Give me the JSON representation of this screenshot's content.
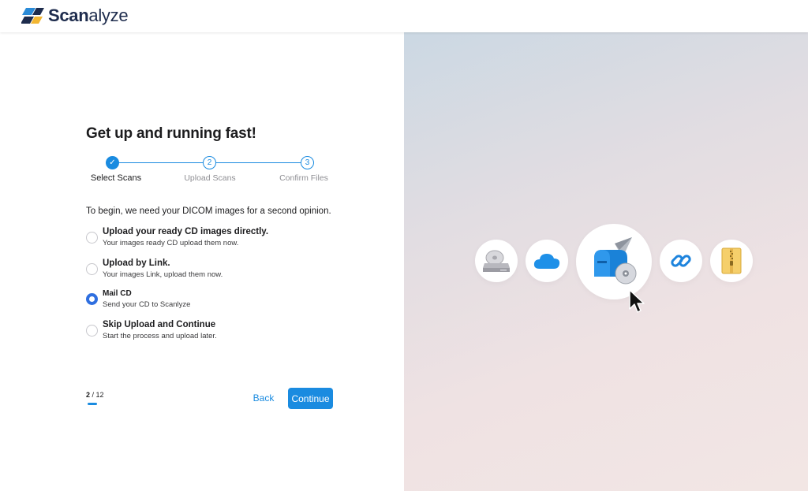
{
  "brand": {
    "name_bold": "Scan",
    "name_rest": "alyze"
  },
  "page": {
    "title": "Get up and running fast!"
  },
  "stepper": {
    "steps": [
      {
        "label": "Select Scans",
        "number": "✓"
      },
      {
        "label": "Upload Scans",
        "number": "2"
      },
      {
        "label": "Confirm Files",
        "number": "3"
      }
    ]
  },
  "intro": "To begin, we need your DICOM images for a second opinion.",
  "options": [
    {
      "title": "Upload your ready CD  images directly.",
      "subtitle": "Your images ready CD upload them now."
    },
    {
      "title": "Upload by Link.",
      "subtitle": "Your images Link, upload them now."
    },
    {
      "title": "Mail CD",
      "subtitle": "Send your CD to Scanlyze"
    },
    {
      "title": "Skip Upload and Continue",
      "subtitle": "Start the process and upload later."
    }
  ],
  "selected_option": 2,
  "pager": {
    "current": "2",
    "total": "/ 12"
  },
  "buttons": {
    "back": "Back",
    "continue": "Continue"
  },
  "icons": [
    "cd-drive-icon",
    "cloud-icon",
    "mailbox-cd-icon",
    "link-icon",
    "zip-folder-icon",
    "cursor-icon"
  ],
  "colors": {
    "accent": "#1a8be0",
    "radio_checked": "#2f6fe0",
    "brand_dark": "#1e2c4d"
  }
}
